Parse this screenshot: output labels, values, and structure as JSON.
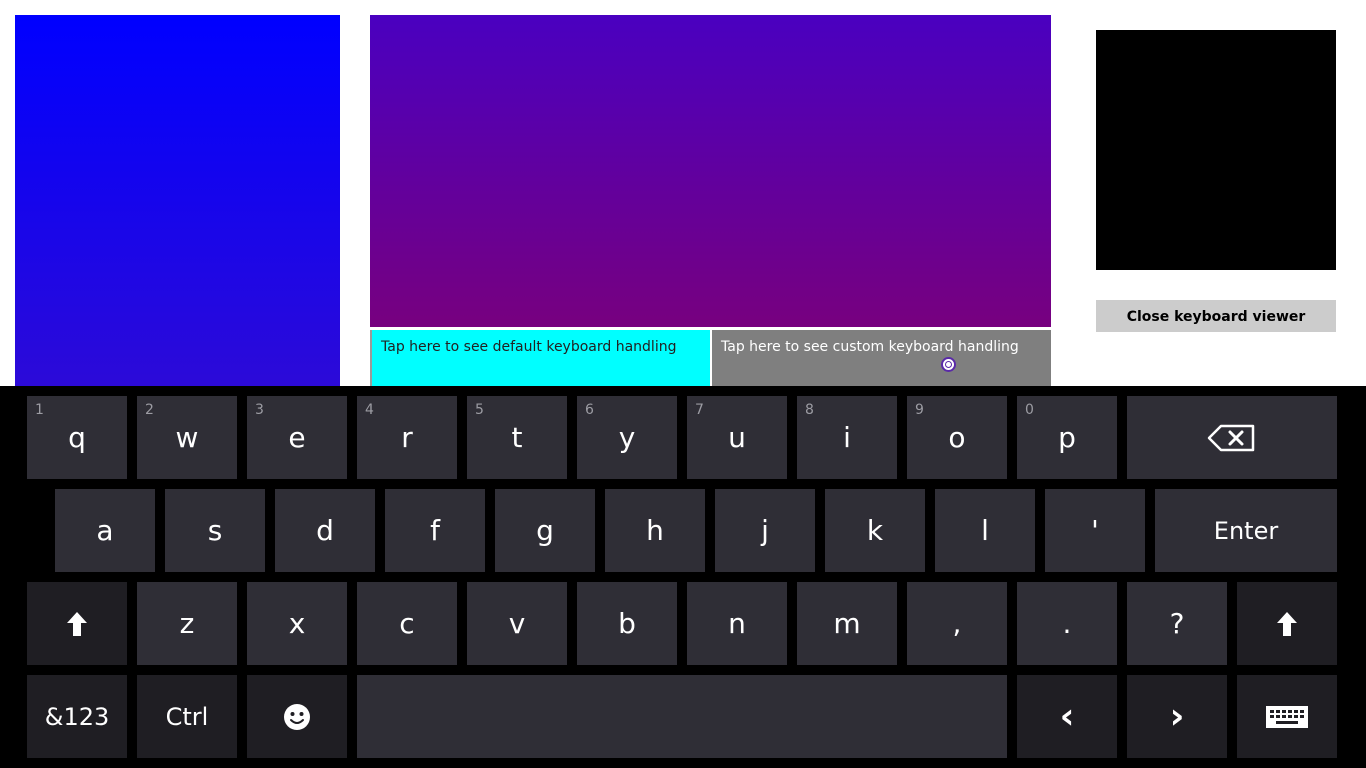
{
  "app": {
    "tap_default_label": "Tap here to see default keyboard handling",
    "tap_custom_label": "Tap here to see custom keyboard handling",
    "close_viewer_label": "Close keyboard viewer"
  },
  "colors": {
    "left_panel": "#0000ff",
    "center_panel_top": "#4a00c0",
    "center_panel_bottom": "#77007f",
    "tap_default_bg": "#00ffff",
    "tap_custom_bg": "#7f7f7f",
    "viewer_bg": "#000000",
    "key_bg": "#2f2e36",
    "key_dark_bg": "#1f1e23"
  },
  "keyboard": {
    "row1": [
      {
        "num": "1",
        "label": "q"
      },
      {
        "num": "2",
        "label": "w"
      },
      {
        "num": "3",
        "label": "e"
      },
      {
        "num": "4",
        "label": "r"
      },
      {
        "num": "5",
        "label": "t"
      },
      {
        "num": "6",
        "label": "y"
      },
      {
        "num": "7",
        "label": "u"
      },
      {
        "num": "8",
        "label": "i"
      },
      {
        "num": "9",
        "label": "o"
      },
      {
        "num": "0",
        "label": "p"
      }
    ],
    "backspace_icon": "backspace-icon",
    "row2": [
      "a",
      "s",
      "d",
      "f",
      "g",
      "h",
      "j",
      "k",
      "l",
      "'"
    ],
    "enter_label": "Enter",
    "shift_icon": "shift-arrow-icon",
    "row3": [
      "z",
      "x",
      "c",
      "v",
      "b",
      "n",
      "m",
      ",",
      ".",
      "?"
    ],
    "symbols_label": "&123",
    "ctrl_label": "Ctrl",
    "emoji_icon": "smiley-icon",
    "left_label": "‹",
    "right_label": "›",
    "hide_keyboard_icon": "keyboard-icon"
  }
}
